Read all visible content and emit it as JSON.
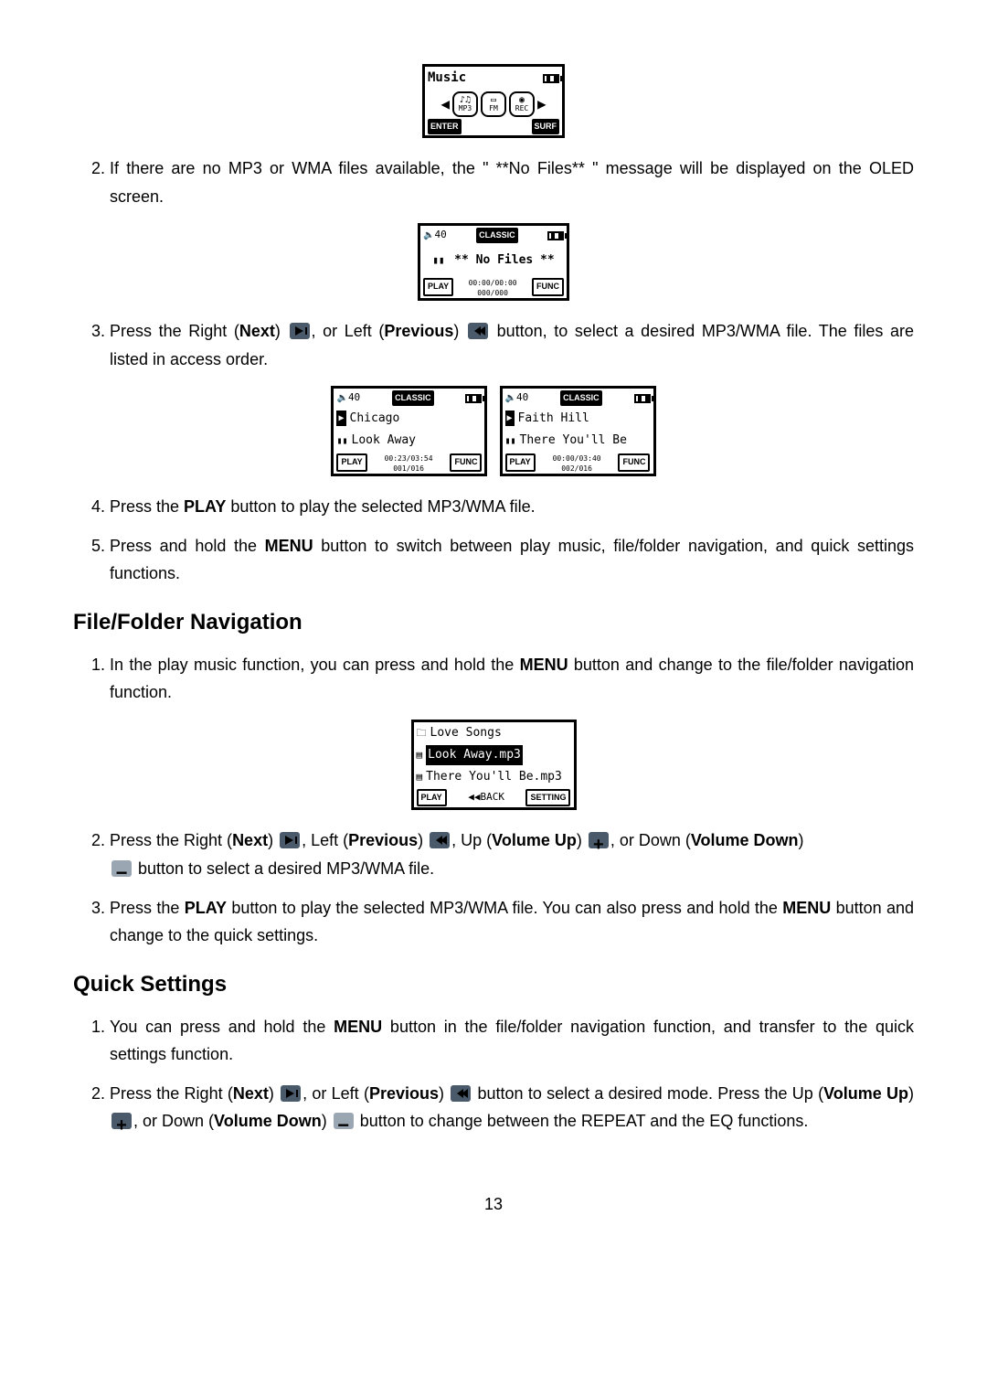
{
  "fig1": {
    "title": "Music",
    "bottom_left": "ENTER",
    "bottom_right": "SURF",
    "icon1_sub": "MP3",
    "icon2_sub": "FM",
    "icon3_sub": "REC"
  },
  "item2": {
    "text_a": "If there are no MP3 or WMA files available, the \" **No Files** \" message will be displayed on the OLED screen."
  },
  "fig2": {
    "vol": "40",
    "mode": "CLASSIC",
    "msg": "** No Files **",
    "play": "PLAY",
    "time": "00:00/00:00",
    "count": "000/000",
    "func": "FUNC"
  },
  "item3": {
    "text_a": "Press the Right (",
    "next": "Next",
    "text_b": ") ",
    "text_c": ", or Left (",
    "prev": "Previous",
    "text_d": ") ",
    "text_e": " button, to select a desired MP3/WMA file. The files are listed in access order."
  },
  "fig3a": {
    "vol": "40",
    "mode": "CLASSIC",
    "line1": "Chicago",
    "line2": "Look Away",
    "play": "PLAY",
    "time": "00:23/03:54",
    "count": "001/016",
    "func": "FUNC"
  },
  "fig3b": {
    "vol": "40",
    "mode": "CLASSIC",
    "line1": "Faith Hill",
    "line2": "There You'll Be",
    "play": "PLAY",
    "time": "00:00/03:40",
    "count": "002/016",
    "func": "FUNC"
  },
  "item4": {
    "text_a": "Press the ",
    "play": "PLAY",
    "text_b": " button to play the selected MP3/WMA file."
  },
  "item5": {
    "text_a": "Press and hold the ",
    "menu": "MENU",
    "text_b": " button to switch between play music, file/folder navigation, and quick settings functions."
  },
  "sec1_title": "File/Folder Navigation",
  "sec1_item1": {
    "text_a": "In the play music function, you can press and hold the ",
    "menu": "MENU",
    "text_b": " button and change to the file/folder navigation function."
  },
  "fig4": {
    "line1": "Love Songs",
    "line2": "Look Away.mp3",
    "line3": "There You'll Be.mp3",
    "play": "PLAY",
    "back": "BACK",
    "setting": "SETTING"
  },
  "sec1_item2": {
    "text_a": "Press the Right (",
    "next": "Next",
    "text_b": ") ",
    "text_c": ", Left (",
    "prev": "Previous",
    "text_d": ") ",
    "text_e": ", Up (",
    "volup": "Volume Up",
    "text_f": ") ",
    "text_g": ", or Down (",
    "voldown": "Volume Down",
    "text_h": ") ",
    "text_i": " button to select a desired MP3/WMA file."
  },
  "sec1_item3": {
    "text_a": "Press the ",
    "play": "PLAY",
    "text_b": " button to play the selected MP3/WMA file. You can also press and hold the ",
    "menu": "MENU",
    "text_c": " button and change to the quick settings."
  },
  "sec2_title": "Quick Settings",
  "sec2_item1": {
    "text_a": "You can press and hold the ",
    "menu": "MENU",
    "text_b": " button in the file/folder navigation function, and transfer to the quick settings function."
  },
  "sec2_item2": {
    "text_a": "Press the Right (",
    "next": "Next",
    "text_b": ") ",
    "text_c": ", or Left (",
    "prev": "Previous",
    "text_d": ") ",
    "text_e": " button to select a desired mode. Press the Up (",
    "volup": "Volume Up",
    "text_f": ") ",
    "text_g": ", or Down (",
    "voldown": "Volume Down",
    "text_h": ") ",
    "text_i": " button to change between the REPEAT and the EQ functions."
  },
  "page_number": "13"
}
